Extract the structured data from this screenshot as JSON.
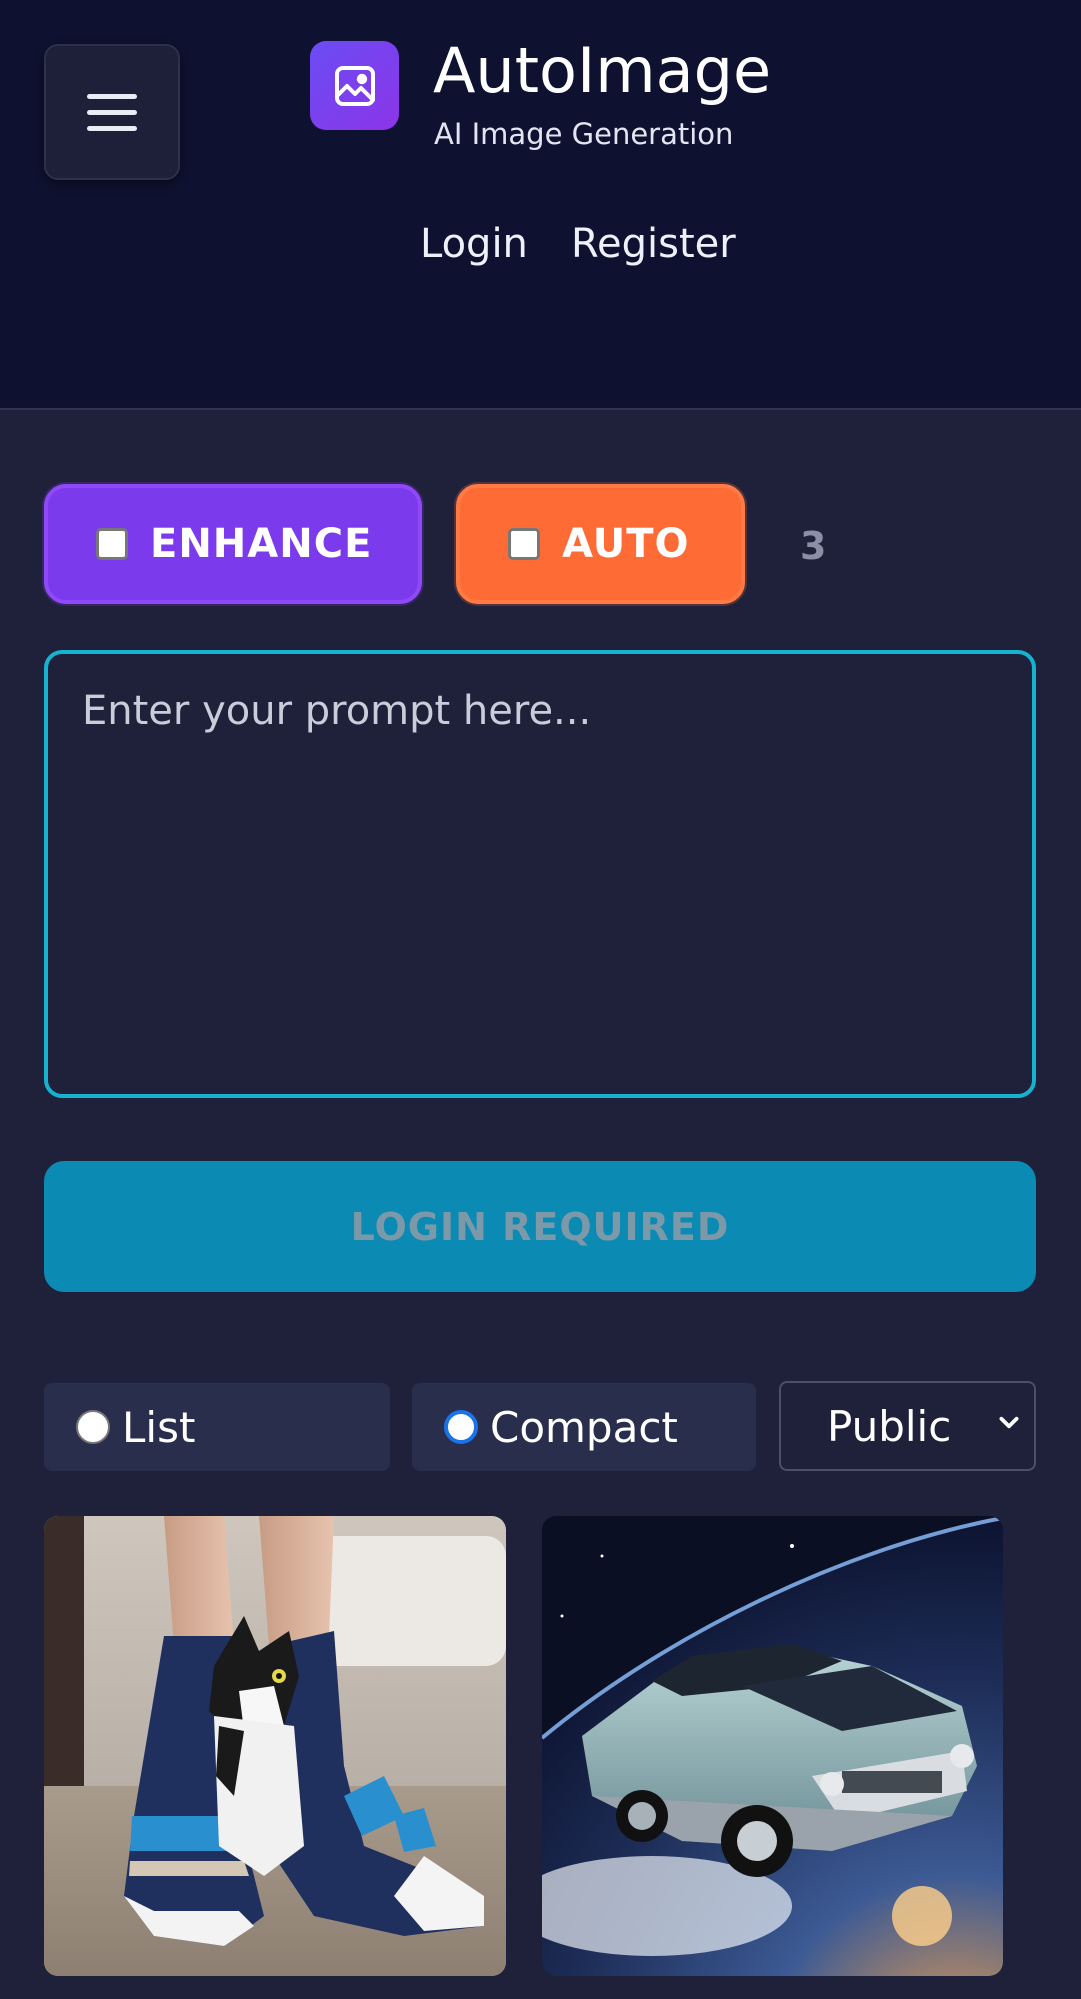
{
  "header": {
    "app_title": "AutoImage",
    "app_subtitle": "AI Image Generation",
    "nav": {
      "login": "Login",
      "register": "Register"
    },
    "logo_icon": "image-icon",
    "menu_icon": "hamburger-icon"
  },
  "controls": {
    "enhance_label": "ENHANCE",
    "enhance_checked": false,
    "auto_label": "AUTO",
    "auto_checked": false,
    "counter": "3"
  },
  "prompt": {
    "value": "",
    "placeholder": "Enter your prompt here..."
  },
  "submit": {
    "label": "LOGIN REQUIRED"
  },
  "view": {
    "list_label": "List",
    "compact_label": "Compact",
    "selected": "Compact",
    "visibility_selected": "Public"
  },
  "gallery": [
    {
      "subject": "cat-in-striped-sock"
    },
    {
      "subject": "classic-car-in-space"
    }
  ],
  "colors": {
    "header_bg": "#0e1230",
    "page_bg": "#1e2139",
    "enhance": "#7c3aed",
    "auto": "#ff6b35",
    "accent": "#16b3d0",
    "login_button": "#0b8ab4"
  }
}
